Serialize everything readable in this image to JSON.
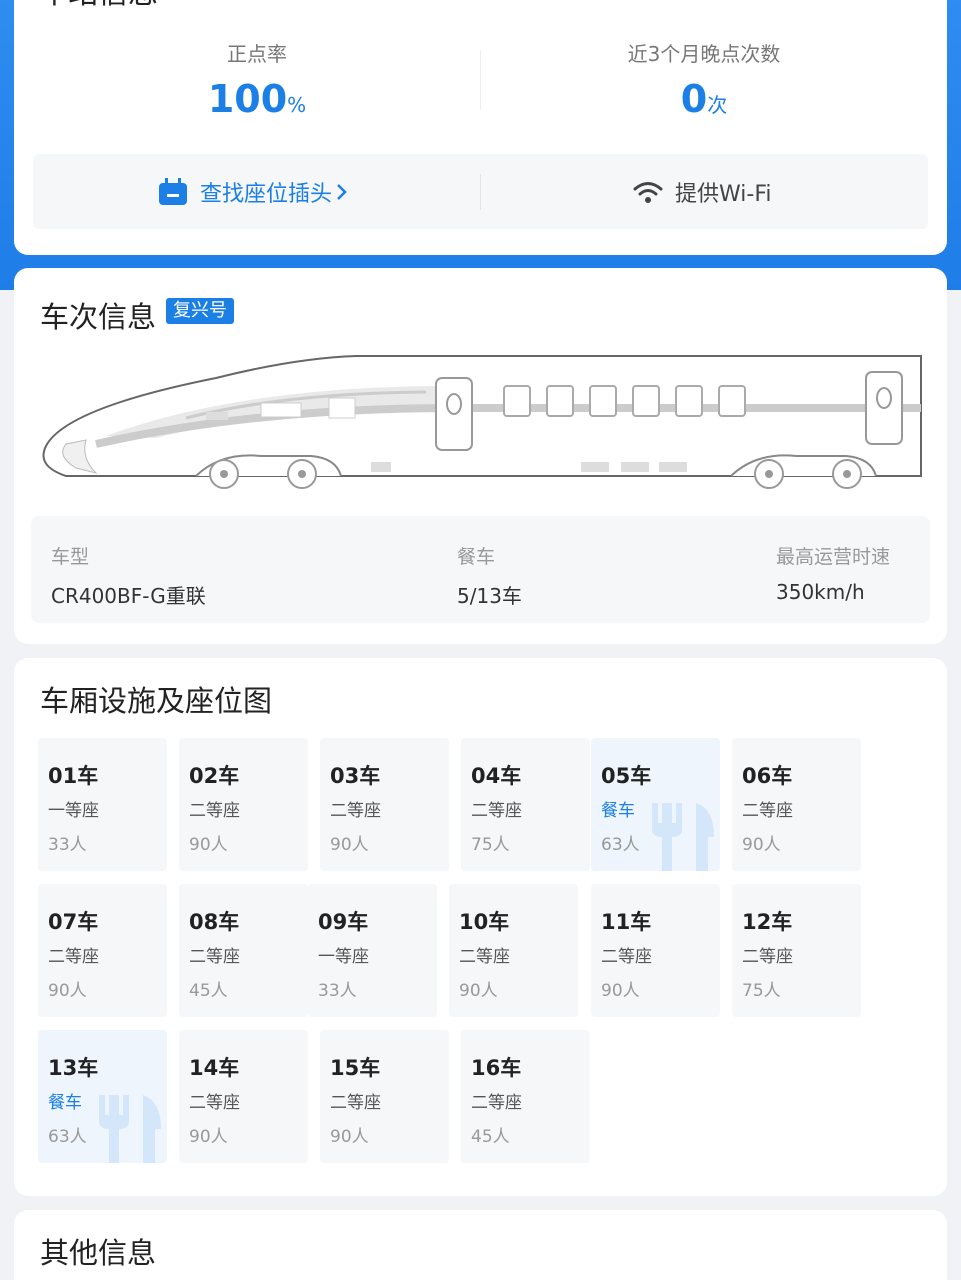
{
  "top": {
    "clipped_title": "车站信息",
    "punctuality": {
      "label": "正点率",
      "value": "100",
      "unit": "%"
    },
    "late_count": {
      "label": "近3个月晚点次数",
      "value": "0",
      "unit": "次"
    },
    "seat_plug_link": "查找座位插头",
    "wifi_label": "提供Wi-Fi"
  },
  "train_info": {
    "title": "车次信息",
    "badge": "复兴号",
    "specs": [
      {
        "key": "车型",
        "value": "CR400BF-G重联"
      },
      {
        "key": "餐车",
        "value": "5/13车"
      },
      {
        "key": "最高运营时速",
        "value": "350km/h"
      }
    ]
  },
  "cars_section": {
    "title": "车厢设施及座位图",
    "cars": [
      {
        "num": "01车",
        "type": "一等座",
        "count": "33人",
        "dining": false
      },
      {
        "num": "02车",
        "type": "二等座",
        "count": "90人",
        "dining": false
      },
      {
        "num": "03车",
        "type": "二等座",
        "count": "90人",
        "dining": false
      },
      {
        "num": "04车",
        "type": "二等座",
        "count": "75人",
        "dining": false
      },
      {
        "num": "05车",
        "type": "餐车",
        "count": "63人",
        "dining": true
      },
      {
        "num": "06车",
        "type": "二等座",
        "count": "90人",
        "dining": false
      },
      {
        "num": "07车",
        "type": "二等座",
        "count": "90人",
        "dining": false
      },
      {
        "num": "08车",
        "type": "二等座",
        "count": "45人",
        "dining": false
      },
      {
        "num": "09车",
        "type": "一等座",
        "count": "33人",
        "dining": false
      },
      {
        "num": "10车",
        "type": "二等座",
        "count": "90人",
        "dining": false
      },
      {
        "num": "11车",
        "type": "二等座",
        "count": "90人",
        "dining": false
      },
      {
        "num": "12车",
        "type": "二等座",
        "count": "75人",
        "dining": false
      },
      {
        "num": "13车",
        "type": "餐车",
        "count": "63人",
        "dining": true
      },
      {
        "num": "14车",
        "type": "二等座",
        "count": "90人",
        "dining": false
      },
      {
        "num": "15车",
        "type": "二等座",
        "count": "90人",
        "dining": false
      },
      {
        "num": "16车",
        "type": "二等座",
        "count": "45人",
        "dining": false
      }
    ]
  },
  "other": {
    "title": "其他信息"
  },
  "colors": {
    "accent": "#1b7fe5",
    "header_blue": "#2f8cf0"
  }
}
